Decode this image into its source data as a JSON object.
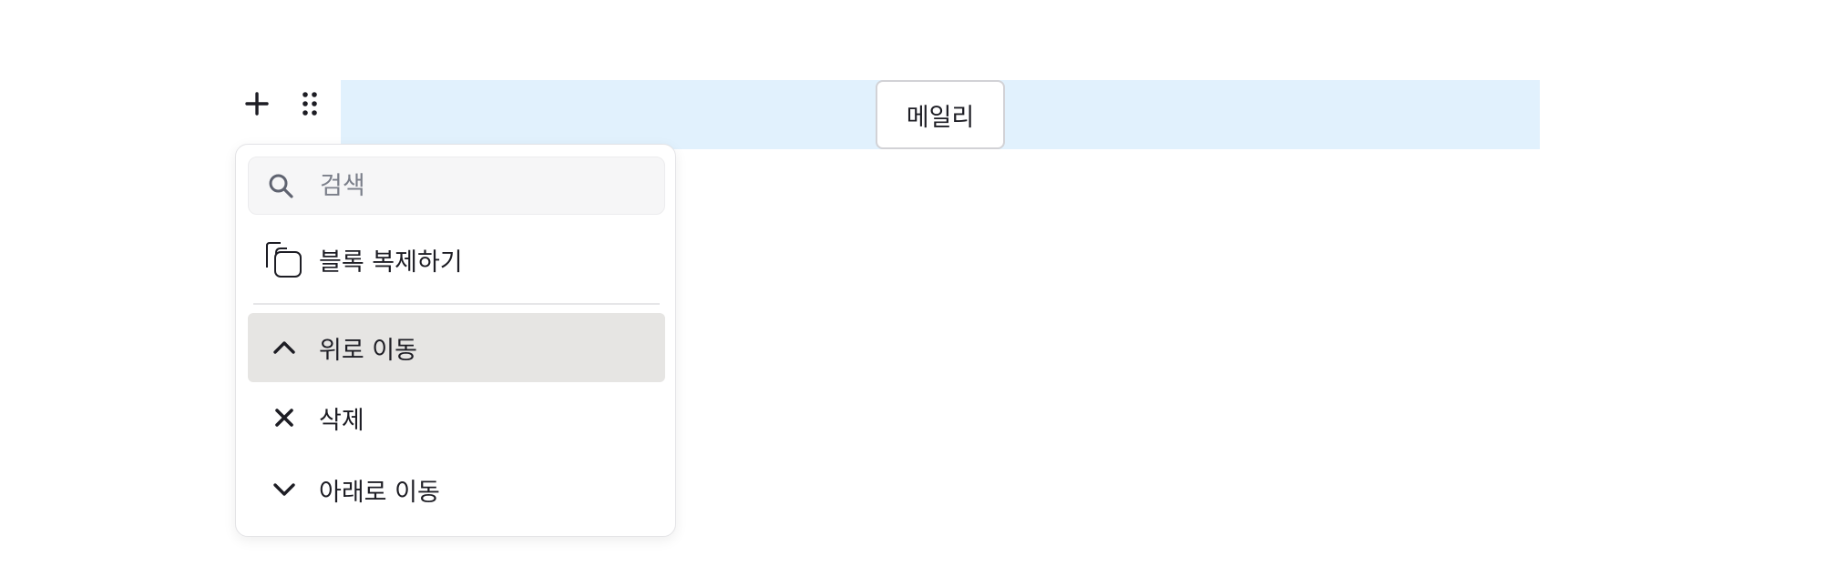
{
  "block": {
    "button_label": "메일리"
  },
  "menu": {
    "search_placeholder": "검색",
    "items": [
      {
        "label": "블록 복제하기",
        "icon": "duplicate-icon"
      },
      {
        "label": "위로 이동",
        "icon": "chevron-up-icon"
      },
      {
        "label": "삭제",
        "icon": "close-icon"
      },
      {
        "label": "아래로 이동",
        "icon": "chevron-down-icon"
      }
    ]
  },
  "colors": {
    "block_highlight": "#e1f1fd",
    "hover_row": "#e6e5e3",
    "text": "#1d1d24",
    "placeholder": "#7b7f8a"
  }
}
